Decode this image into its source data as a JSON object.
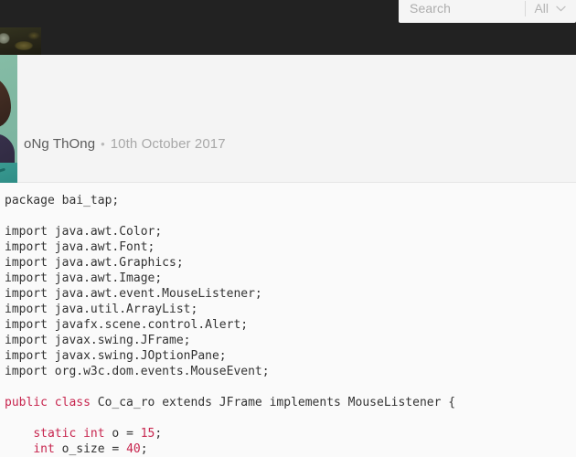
{
  "header": {
    "background": "#222222"
  },
  "search": {
    "placeholder": "Search",
    "value": "",
    "scope_label": "All",
    "scope_icon": "chevron-down-icon"
  },
  "post": {
    "author": "oNg ThOng",
    "separator": "•",
    "date": "10th October 2017",
    "avatar_alt": "user-avatar"
  },
  "code": {
    "language": "java",
    "keyword_color": "#c7254e",
    "text_color": "#333333",
    "background": "#fafafa",
    "lines": [
      [
        {
          "t": "package bai_tap;",
          "k": false
        }
      ],
      [
        {
          "t": "",
          "k": false
        }
      ],
      [
        {
          "t": "import java.awt.Color;",
          "k": false
        }
      ],
      [
        {
          "t": "import java.awt.Font;",
          "k": false
        }
      ],
      [
        {
          "t": "import java.awt.Graphics;",
          "k": false
        }
      ],
      [
        {
          "t": "import java.awt.Image;",
          "k": false
        }
      ],
      [
        {
          "t": "import java.awt.event.MouseListener;",
          "k": false
        }
      ],
      [
        {
          "t": "import java.util.ArrayList;",
          "k": false
        }
      ],
      [
        {
          "t": "import javafx.scene.control.Alert;",
          "k": false
        }
      ],
      [
        {
          "t": "import javax.swing.JFrame;",
          "k": false
        }
      ],
      [
        {
          "t": "import javax.swing.JOptionPane;",
          "k": false
        }
      ],
      [
        {
          "t": "import org.w3c.dom.events.MouseEvent;",
          "k": false
        }
      ],
      [
        {
          "t": "",
          "k": false
        }
      ],
      [
        {
          "t": "public class",
          "k": true
        },
        {
          "t": " Co_ca_ro extends JFrame implements MouseListener {",
          "k": false
        }
      ],
      [
        {
          "t": "",
          "k": false
        }
      ],
      [
        {
          "t": "    ",
          "k": false
        },
        {
          "t": "static int",
          "k": true
        },
        {
          "t": " o = ",
          "k": false
        },
        {
          "t": "15",
          "k": true
        },
        {
          "t": ";",
          "k": false
        }
      ],
      [
        {
          "t": "    ",
          "k": false
        },
        {
          "t": "int",
          "k": true
        },
        {
          "t": " o_size = ",
          "k": false
        },
        {
          "t": "40",
          "k": true
        },
        {
          "t": ";",
          "k": false
        }
      ]
    ]
  }
}
